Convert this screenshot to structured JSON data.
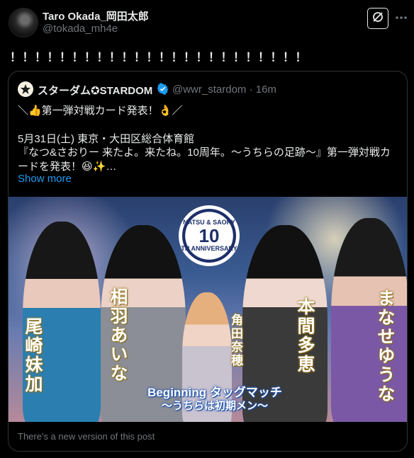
{
  "post": {
    "author_name": "Taro Okada_岡田太郎",
    "author_handle": "@tokada_mh4e",
    "text": "！！！！！！！！！！！！！！！！！！！！！！！！"
  },
  "quoted_post": {
    "author_name": "スターダム✪STARDOM",
    "author_handle": "@wwr_stardom · 16m",
    "line1": "＼👍第一弾対戦カード発表！👌／",
    "line2": "5月31日(土) 東京・大田区総合体育館",
    "line3": "『なつ&さおりー 来たよ。来たね。10周年。〜うちらの足跡〜』第一弾対戦カードを発表！😆✨…",
    "show_more": "Show more",
    "media": {
      "logo_top": "NATSU & SAORY",
      "logo_number": "10",
      "logo_bottom": "TH ANNIVERSARY",
      "wrestler_1": "尾崎妹加",
      "wrestler_2": "相羽あいな",
      "wrestler_3": "角田奈穂",
      "wrestler_4": "本間多恵",
      "wrestler_5": "まなせゆうな",
      "event_title": "Beginning タッグマッチ",
      "event_subtitle": "〜うちらは初期メン〜"
    },
    "new_version_note": "There's a new version of this post"
  },
  "icons": {
    "grok": "grok-icon",
    "more": "more-icon",
    "verified": "verified-badge-icon"
  },
  "colors": {
    "background": "#000000",
    "text": "#e7e9ea",
    "secondary": "#71767b",
    "link": "#1d9bf0",
    "border": "#2f3336"
  }
}
